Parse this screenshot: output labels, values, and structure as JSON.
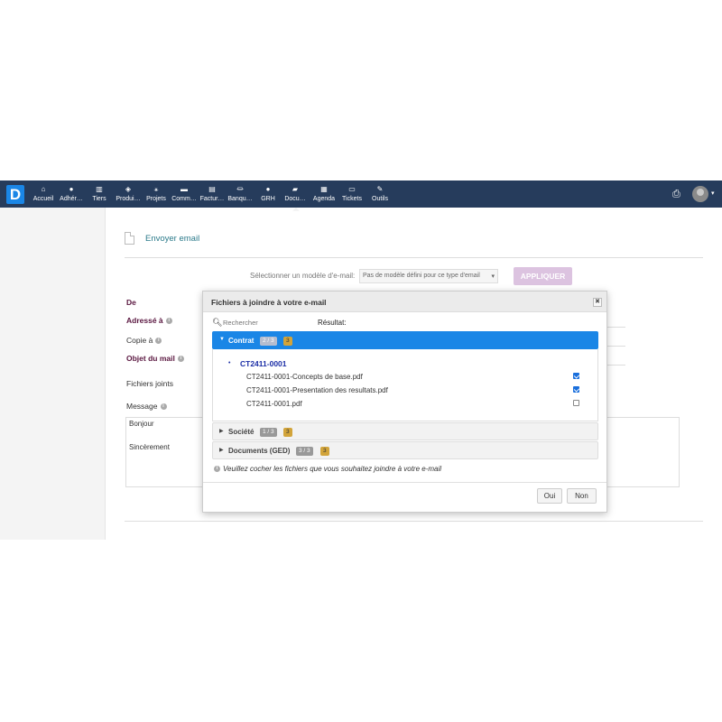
{
  "nav": {
    "logo": "D",
    "items": [
      {
        "label": "Accueil",
        "icon": "home-icon",
        "glyph": "⌂"
      },
      {
        "label": "Adhér…",
        "icon": "member-icon",
        "glyph": "●"
      },
      {
        "label": "Tiers",
        "icon": "building-icon",
        "glyph": "▥"
      },
      {
        "label": "Produi…",
        "icon": "cube-icon",
        "glyph": "◈"
      },
      {
        "label": "Projets",
        "icon": "project-icon",
        "glyph": "⚹"
      },
      {
        "label": "Comm…",
        "icon": "briefcase-icon",
        "glyph": "▬"
      },
      {
        "label": "Factur…",
        "icon": "invoice-icon",
        "glyph": "▤"
      },
      {
        "label": "Banqu…",
        "icon": "bank-icon",
        "glyph": "⏛"
      },
      {
        "label": "GRH",
        "icon": "hr-icon",
        "glyph": "●"
      },
      {
        "label": "Docu…",
        "icon": "folder-icon",
        "glyph": "▰"
      },
      {
        "label": "Agenda",
        "icon": "calendar-icon",
        "glyph": "▦"
      },
      {
        "label": "Tickets",
        "icon": "ticket-icon",
        "glyph": "▭"
      },
      {
        "label": "Outils",
        "icon": "wrench-icon",
        "glyph": "✎"
      }
    ],
    "print_glyph": "⎙",
    "caret": "▾"
  },
  "page": {
    "title": "Envoyer email",
    "model_label": "Sélectionner un modèle d'e-mail:",
    "model_select": "Pas de modèle défini pour ce type d'email",
    "apply_button": "APPLIQUER",
    "fields": {
      "de": "De",
      "adresse": "Adressé à",
      "copie": "Copie à",
      "objet": "Objet du mail",
      "fichiers": "Fichiers joints",
      "message": "Message"
    },
    "message_lines": [
      "Bonjour",
      "Sincèrement"
    ]
  },
  "modal": {
    "title": "Fichiers à joindre à votre e-mail",
    "close": "✖",
    "search_placeholder": "Rechercher",
    "result_label": "Résultat:",
    "categories": [
      {
        "name": "Contrat",
        "ratio": "2 / 3",
        "count": "3",
        "open": true
      },
      {
        "name": "Société",
        "ratio": "1 / 3",
        "count": "3",
        "open": false
      },
      {
        "name": "Documents (GED)",
        "ratio": "3 / 3",
        "count": "3",
        "open": false
      }
    ],
    "group": "CT2411-0001",
    "files": [
      {
        "name": "CT2411-0001-Concepts de base.pdf",
        "checked": true
      },
      {
        "name": "CT2411-0001-Presentation des resultats.pdf",
        "checked": true
      },
      {
        "name": "CT2411-0001.pdf",
        "checked": false
      }
    ],
    "hint": "Veuillez cocher les fichiers que vous souhaitez joindre à votre e-mail",
    "ok_button": "Oui",
    "cancel_button": "Non"
  }
}
